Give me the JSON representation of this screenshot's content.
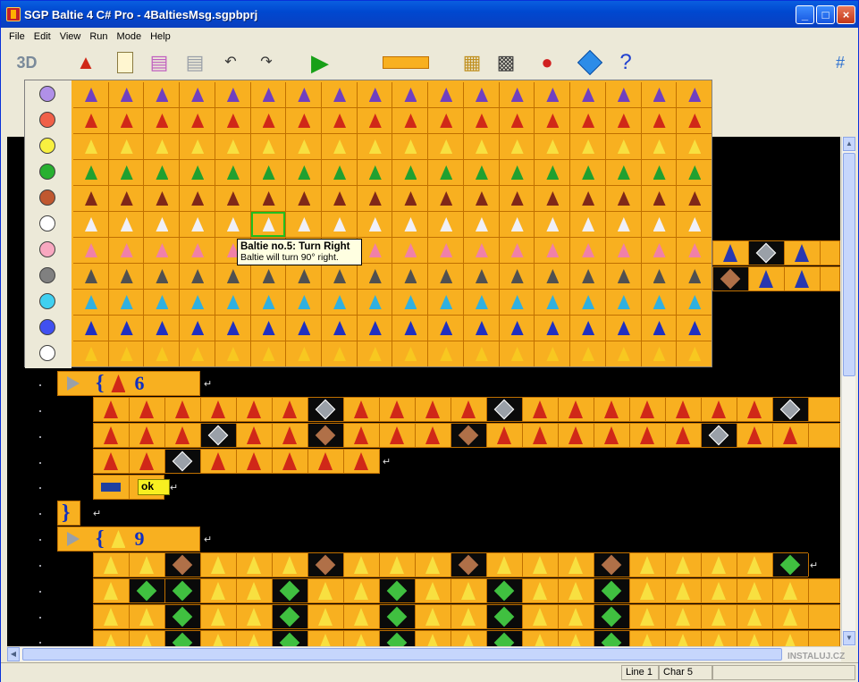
{
  "window": {
    "title": "SGP Baltie 4 C# Pro - 4BaltiesMsg.sgpbprj"
  },
  "menu": [
    "File",
    "Edit",
    "View",
    "Run",
    "Mode",
    "Help"
  ],
  "toolbar": {
    "mode_label": "3D",
    "help_label": "?",
    "grid_label": "#"
  },
  "palette": {
    "colors": [
      "#B090E8",
      "#F06048",
      "#F8F040",
      "#28B030",
      "#C05830",
      "#FFFFFF",
      "#F8A8C0",
      "#808080",
      "#40D0F0",
      "#4050F0",
      "#FFFFFF"
    ],
    "wizard_colors": [
      "#7040C0",
      "#D02818",
      "#F8E040",
      "#20A030",
      "#802818",
      "#F0F0F8",
      "#F080A8",
      "#505050",
      "#30B0E0",
      "#2030C0",
      "#F8C820"
    ],
    "selected_row": 5,
    "selected_col": 5
  },
  "tooltip": {
    "title": "Baltie no.5: Turn Right",
    "text": "Baltie will turn 90° right."
  },
  "code": {
    "repeat1": "6",
    "repeat2": "9",
    "message": "ok"
  },
  "status": {
    "line": "Line 1",
    "char": "Char 5"
  },
  "watermark": "INSTALUJ.CZ"
}
